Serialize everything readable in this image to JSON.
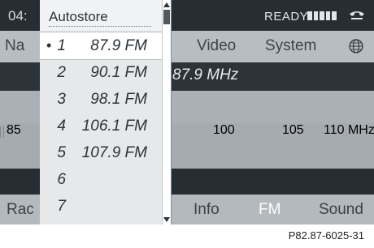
{
  "status": {
    "clock": "04:",
    "ready": "READY"
  },
  "menu": {
    "items": [
      "Na",
      "Video",
      "System"
    ]
  },
  "station": {
    "freq_text": "87.9 MHz"
  },
  "scale": {
    "labels": [
      "85",
      "100",
      "105",
      "110 MHz"
    ]
  },
  "dropdown": {
    "title": "Autostore",
    "items": [
      {
        "num": "1",
        "freq": "87.9 FM",
        "selected": true
      },
      {
        "num": "2",
        "freq": "90.1 FM",
        "selected": false
      },
      {
        "num": "3",
        "freq": "98.1 FM",
        "selected": false
      },
      {
        "num": "4",
        "freq": "106.1 FM",
        "selected": false
      },
      {
        "num": "5",
        "freq": "107.9 FM",
        "selected": false
      },
      {
        "num": "6",
        "freq": "",
        "selected": false
      },
      {
        "num": "7",
        "freq": "",
        "selected": false
      }
    ]
  },
  "bottom": {
    "items": [
      "Rac",
      "Info",
      "FM",
      "Sound"
    ],
    "active": "FM"
  },
  "reference": "P82.87-6025-31",
  "colors": {
    "dark": "#262d33",
    "panel": "#a9aeb3",
    "dropdown": "#e6e8ea"
  }
}
